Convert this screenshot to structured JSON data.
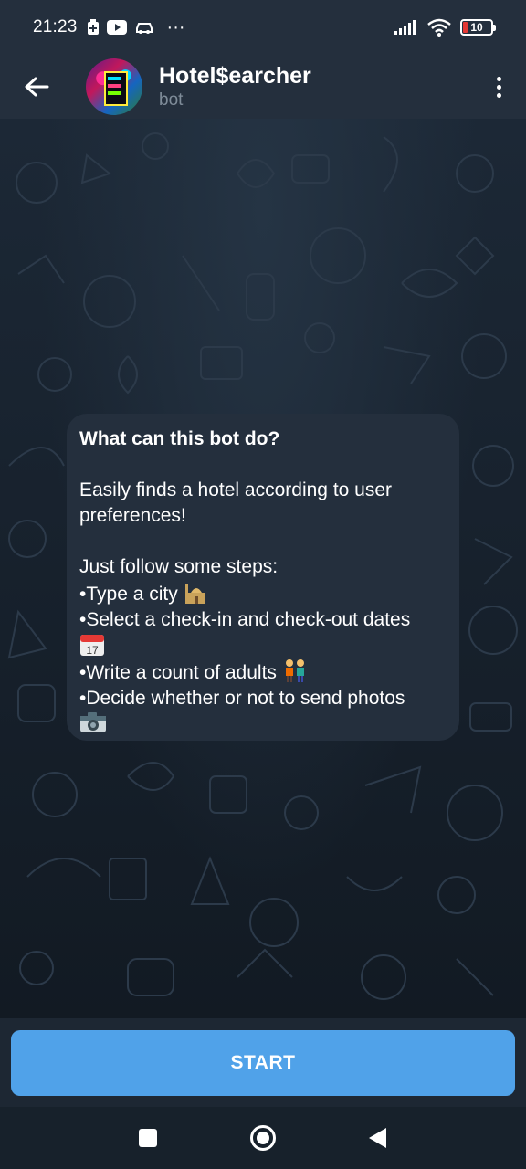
{
  "status_bar": {
    "time": "21:23",
    "more": "···",
    "battery": "10"
  },
  "header": {
    "title": "Hotel$earcher",
    "subtitle": "bot"
  },
  "message": {
    "title": "What can this bot do?",
    "intro_line1": "Easily finds a hotel according to user",
    "intro_line2": "preferences!",
    "steps_heading": "Just follow some steps:",
    "step_city": "•Type a city",
    "step_dates": "•Select a check-in and check-out dates",
    "step_adults": "•Write a count of adults",
    "step_photos": "•Decide whether or not to send photos"
  },
  "footer": {
    "start_label": "START"
  },
  "colors": {
    "header_bg": "#242f3d",
    "chat_bg": "#17212b",
    "bubble_bg": "#242f3d",
    "accent": "#50a2e9",
    "subtitle": "#7f8c99"
  },
  "icons": {
    "back": "arrow-left-icon",
    "menu": "more-vertical-icon",
    "nav_square": "recents-icon",
    "nav_circle": "home-icon",
    "nav_triangle": "back-icon"
  }
}
